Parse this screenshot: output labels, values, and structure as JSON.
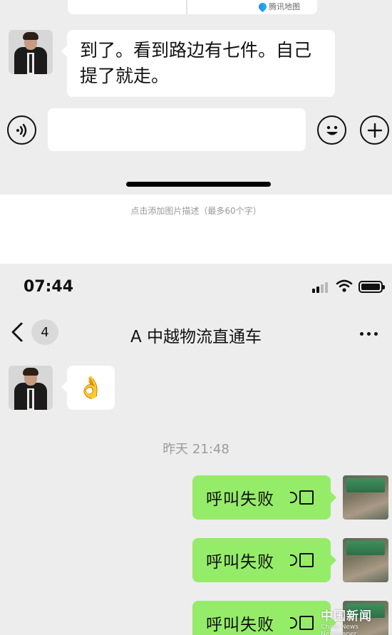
{
  "top_screenshot": {
    "map_logo_label": "腾讯地图",
    "message_text": "到了。看到路边有七件。自己提了就走。",
    "input_value": ""
  },
  "caption": "点击添加图片描述（最多60个字）",
  "bottom_screenshot": {
    "status": {
      "time": "07:44"
    },
    "nav": {
      "back_badge": "4",
      "title": "A   中越物流直通车"
    },
    "first_message_emoji": "👌",
    "timestamp": "昨天 21:48",
    "messages": [
      {
        "text": "呼叫失败"
      },
      {
        "text": "呼叫失败"
      },
      {
        "text": "呼叫失败"
      }
    ]
  },
  "watermark": {
    "line1": "中国新闻",
    "line2": "China News Newspaper"
  },
  "colors": {
    "background": "#ededed",
    "sent_bubble": "#95ec69",
    "received_bubble": "#ffffff"
  }
}
